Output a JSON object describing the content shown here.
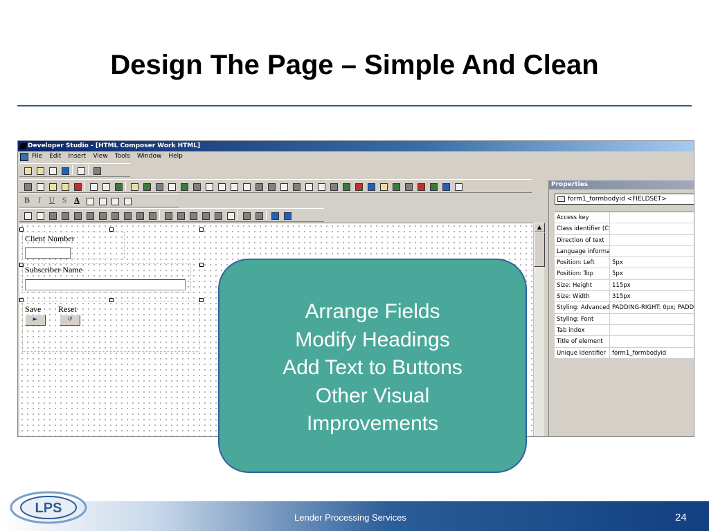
{
  "slide": {
    "title": "Design The Page – Simple And Clean"
  },
  "ide": {
    "window_title": "Developer Studio - [HTML Composer Work HTML]",
    "menu": [
      "File",
      "Edit",
      "Insert",
      "View",
      "Tools",
      "Window",
      "Help"
    ],
    "format_buttons": [
      "B",
      "I",
      "U",
      "S",
      "A"
    ],
    "canvas": {
      "fields": [
        {
          "label": "Client Number"
        },
        {
          "label": "Subscriber Name"
        }
      ],
      "buttons": [
        {
          "label": "Save",
          "glyph": "►"
        },
        {
          "label": "Reset",
          "glyph": "↺"
        }
      ]
    },
    "properties": {
      "title": "Properties",
      "selected_element": "form1_formbodyid <FIELDSET>",
      "rows": [
        {
          "key": "Access key",
          "value": ""
        },
        {
          "key": "Class identifier (CSS",
          "value": ""
        },
        {
          "key": "Direction of text",
          "value": ""
        },
        {
          "key": "Language informatic",
          "value": ""
        },
        {
          "key": "Position: Left",
          "value": "5px"
        },
        {
          "key": "Position: Top",
          "value": "5px"
        },
        {
          "key": "Size: Height",
          "value": "115px"
        },
        {
          "key": "Size: Width",
          "value": "315px"
        },
        {
          "key": "Styling: Advanced (",
          "value": "PADDING-RIGHT: 0px; PADD"
        },
        {
          "key": "Styling: Font",
          "value": ""
        },
        {
          "key": "Tab index",
          "value": ""
        },
        {
          "key": "Title of element",
          "value": ""
        },
        {
          "key": "Unique Identifier",
          "value": "form1_formbodyid"
        }
      ]
    }
  },
  "callout": {
    "lines": [
      "Arrange Fields",
      "Modify Headings",
      "Add Text to Buttons",
      "Other Visual",
      "Improvements"
    ]
  },
  "footer": {
    "logo_text": "LPS",
    "company": "Lender Processing Services",
    "page_number": "24"
  },
  "colors": {
    "callout_fill": "#4aa89a",
    "callout_border": "#2f62a0",
    "title_rule": "#2e5a8c",
    "footer_dark": "#113f80"
  }
}
